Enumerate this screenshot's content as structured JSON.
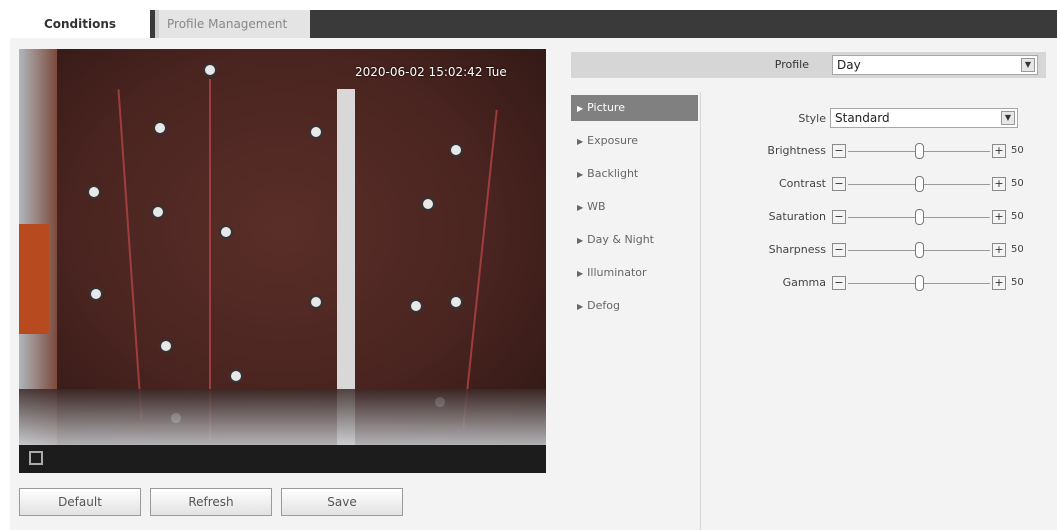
{
  "tabs": [
    {
      "label": "Conditions",
      "active": true
    },
    {
      "label": "Profile Management",
      "active": false
    }
  ],
  "video": {
    "timestamp": "2020-06-02 15:02:42 Tue",
    "fullscreen_icon": "fullscreen-icon"
  },
  "buttons": {
    "default_label": "Default",
    "refresh_label": "Refresh",
    "save_label": "Save"
  },
  "profile": {
    "label": "Profile",
    "value": "Day"
  },
  "menu": {
    "items": [
      {
        "label": "Picture",
        "active": true
      },
      {
        "label": "Exposure",
        "active": false
      },
      {
        "label": "Backlight",
        "active": false
      },
      {
        "label": "WB",
        "active": false
      },
      {
        "label": "Day & Night",
        "active": false
      },
      {
        "label": "Illuminator",
        "active": false
      },
      {
        "label": "Defog",
        "active": false
      }
    ]
  },
  "picture": {
    "style_label": "Style",
    "style_value": "Standard",
    "sliders": [
      {
        "label": "Brightness",
        "value": "50"
      },
      {
        "label": "Contrast",
        "value": "50"
      },
      {
        "label": "Saturation",
        "value": "50"
      },
      {
        "label": "Sharpness",
        "value": "50"
      },
      {
        "label": "Gamma",
        "value": "50"
      }
    ]
  },
  "colors": {
    "tab_bar": "#3a3a3a",
    "menu_active": "#808080",
    "panel_bg": "#f3f3f3"
  }
}
